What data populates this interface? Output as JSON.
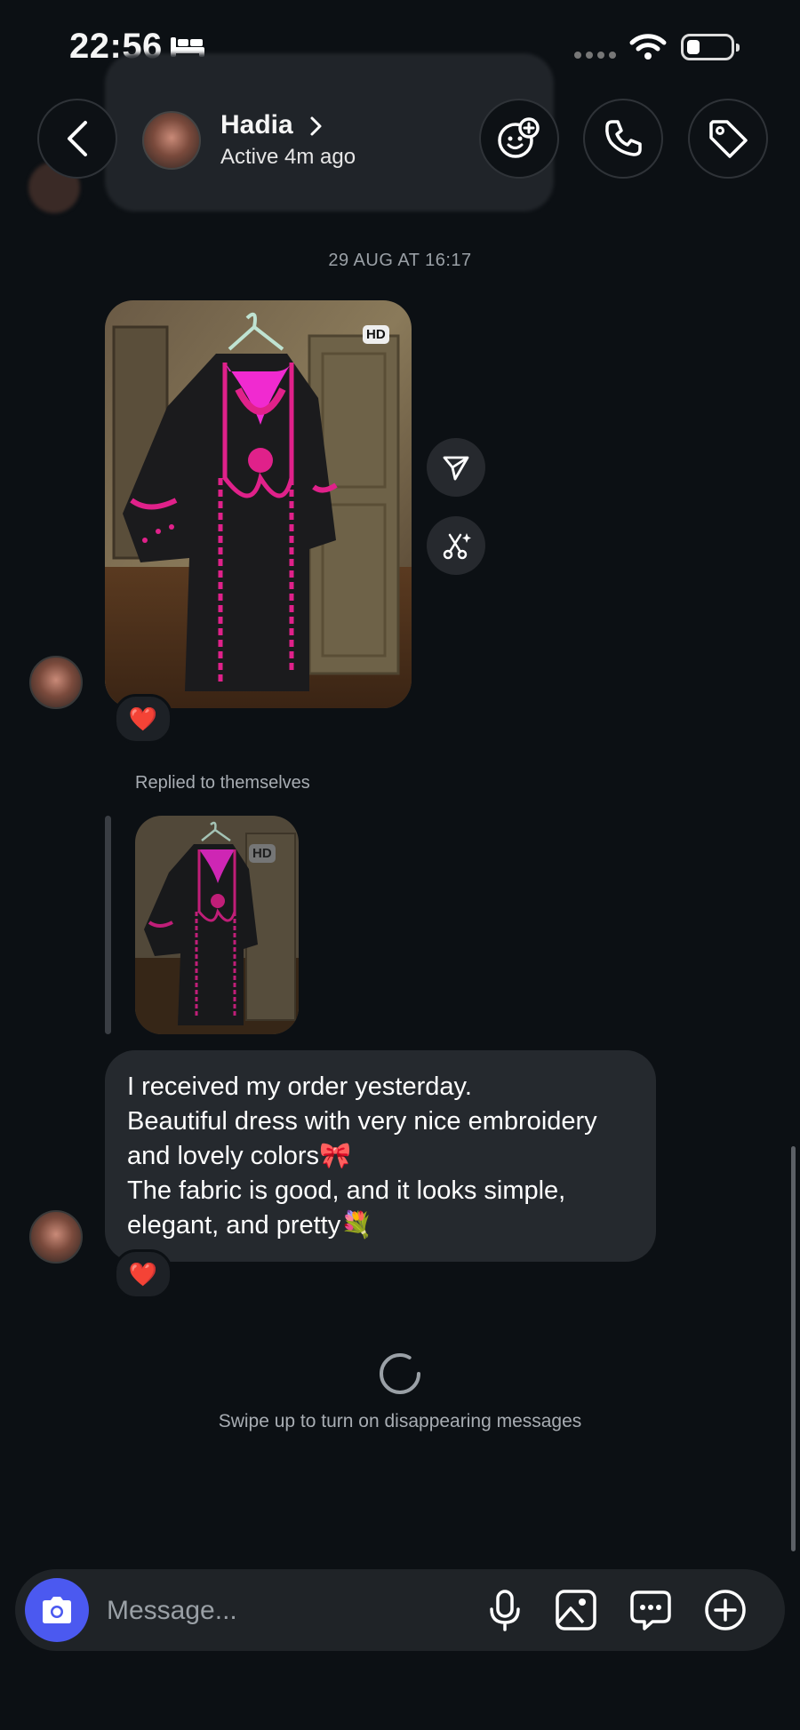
{
  "status_bar": {
    "time": "22:56"
  },
  "header": {
    "name": "Hadia",
    "status": "Active 4m ago"
  },
  "thread": {
    "timestamp": "29 AUG AT 16:17",
    "photo_badge": "HD",
    "photo_reaction": "❤️",
    "reply_label": "Replied to themselves",
    "reply_badge": "HD",
    "message_lines": [
      "I received my order yesterday.",
      "Beautiful dress with very nice embroidery and lovely colors🎀",
      "The fabric is good, and it looks simple, elegant, and pretty💐"
    ],
    "message_reaction": "❤️",
    "disappearing_hint": "Swipe up to turn on disappearing messages"
  },
  "composer": {
    "placeholder": "Message..."
  },
  "colors": {
    "background": "#0c1014",
    "bubble": "#25292e",
    "camera_button": "#4b59f0",
    "embroidery": "#e0218a",
    "heart": "#ed2a40"
  },
  "icons": [
    "bed-icon",
    "wifi-icon",
    "back-icon",
    "add-effect-icon",
    "phone-icon",
    "tag-icon",
    "share-icon",
    "ai-remix-icon",
    "camera-icon",
    "microphone-icon",
    "gallery-icon",
    "sticker-icon",
    "plus-icon"
  ]
}
